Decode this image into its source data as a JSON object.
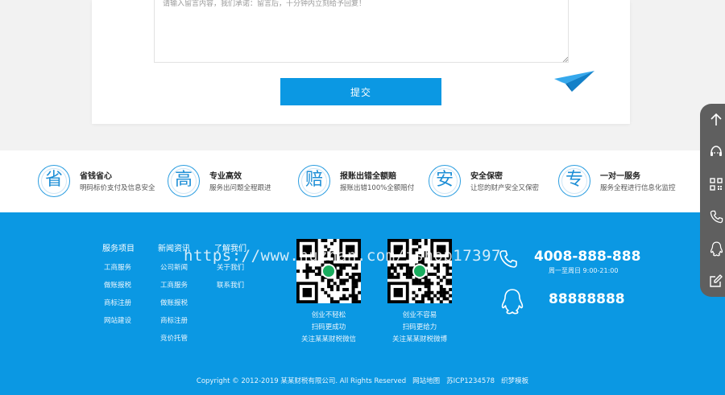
{
  "message_form": {
    "placeholder": "请输入留言内容，我们承诺：留言后，十分钟内立刻给予回复！",
    "submit_label": "提交"
  },
  "features": [
    {
      "glyph": "省",
      "title": "省钱省心",
      "desc": "明码标价支付及信息安全"
    },
    {
      "glyph": "高",
      "title": "专业高效",
      "desc": "服务出问题全程跟进"
    },
    {
      "glyph": "赔",
      "title": "报账出错全额赔",
      "desc": "报账出错100%全额赔付"
    },
    {
      "glyph": "安",
      "title": "安全保密",
      "desc": "让您的财产安全又保密"
    },
    {
      "glyph": "专",
      "title": "一对一服务",
      "desc": "服务全程进行信息化监控"
    }
  ],
  "footer": {
    "columns": [
      {
        "head": "服务项目",
        "links": [
          "工商服务",
          "做账报税",
          "商标注册",
          "网站建设"
        ]
      },
      {
        "head": "新闻资讯",
        "links": [
          "公司新闻",
          "工商服务",
          "做账报税",
          "商标注册",
          "竞价托管"
        ]
      },
      {
        "head": "了解我们",
        "links": [
          "关于我们",
          "联系我们"
        ]
      }
    ],
    "qr_codes": [
      {
        "caption": [
          "创业不轻松",
          "扫码更成功",
          "关注某某财税微信"
        ]
      },
      {
        "caption": [
          "创业不容易",
          "扫码更给力",
          "关注某某财税微博"
        ]
      }
    ],
    "contact": {
      "phone": "4008-888-888",
      "hours": "周一至周日 9:00-21:00",
      "qq": "88888888"
    },
    "copyright": "Copyright © 2012-2019 某某财税有限公司. All Rights Reserved",
    "bottom_links": [
      "网站地图",
      "苏ICP1234578",
      "织梦模板"
    ]
  },
  "watermark": "https://www.huzhan.com/ishop17397",
  "sidebar_icons": [
    "arrow-up-icon",
    "customer-service-icon",
    "qrcode-icon",
    "phone-icon",
    "qq-icon",
    "edit-icon"
  ],
  "colors": {
    "accent": "#0b98e3",
    "sidebar": "#5f5f5f"
  }
}
